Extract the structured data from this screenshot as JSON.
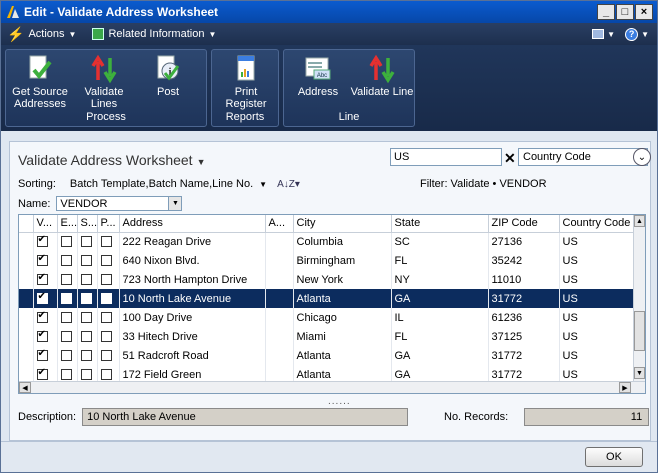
{
  "window": {
    "title": "Edit - Validate Address Worksheet"
  },
  "menu": {
    "actions": "Actions",
    "related": "Related Information"
  },
  "ribbon": {
    "groups": {
      "process": "Process",
      "reports": "Reports",
      "line": "Line"
    },
    "buttons": {
      "get_source": "Get Source Addresses",
      "validate_lines": "Validate Lines",
      "post": "Post",
      "print_register": "Print Register",
      "address": "Address",
      "validate_line": "Validate Line"
    }
  },
  "worksheet": {
    "title": "Validate Address Worksheet",
    "filter_value": "US",
    "filter_field": "Country Code",
    "sorting_label": "Sorting:",
    "sorting_value": "Batch Template,Batch Name,Line No.",
    "filter_text": "Filter: Validate • VENDOR",
    "name_label": "Name:",
    "name_value": "VENDOR"
  },
  "table": {
    "columns": [
      "V...",
      "E...",
      "S...",
      "P...",
      "Address",
      "A...",
      "City",
      "State",
      "ZIP Code",
      "Country Code"
    ],
    "rows": [
      {
        "v": true,
        "e": false,
        "s": false,
        "p": false,
        "address": "222 Reagan Drive",
        "a": "",
        "city": "Columbia",
        "state": "SC",
        "zip": "27136",
        "country": "US",
        "selected": false
      },
      {
        "v": true,
        "e": false,
        "s": false,
        "p": false,
        "address": "640 Nixon Blvd.",
        "a": "",
        "city": "Birmingham",
        "state": "FL",
        "zip": "35242",
        "country": "US",
        "selected": false
      },
      {
        "v": true,
        "e": false,
        "s": false,
        "p": false,
        "address": "723 North Hampton Drive",
        "a": "",
        "city": "New York",
        "state": "NY",
        "zip": "11010",
        "country": "US",
        "selected": false
      },
      {
        "v": true,
        "e": false,
        "s": false,
        "p": false,
        "address": "10 North Lake Avenue",
        "a": "",
        "city": "Atlanta",
        "state": "GA",
        "zip": "31772",
        "country": "US",
        "selected": true
      },
      {
        "v": true,
        "e": false,
        "s": false,
        "p": false,
        "address": "100 Day Drive",
        "a": "",
        "city": "Chicago",
        "state": "IL",
        "zip": "61236",
        "country": "US",
        "selected": false
      },
      {
        "v": true,
        "e": false,
        "s": false,
        "p": false,
        "address": "33 Hitech Drive",
        "a": "",
        "city": "Miami",
        "state": "FL",
        "zip": "37125",
        "country": "US",
        "selected": false
      },
      {
        "v": true,
        "e": false,
        "s": false,
        "p": false,
        "address": "51 Radcroft Road",
        "a": "",
        "city": "Atlanta",
        "state": "GA",
        "zip": "31772",
        "country": "US",
        "selected": false
      },
      {
        "v": true,
        "e": false,
        "s": false,
        "p": false,
        "address": "172 Field Green",
        "a": "",
        "city": "Atlanta",
        "state": "GA",
        "zip": "31772",
        "country": "US",
        "selected": false
      }
    ]
  },
  "details": {
    "description_label": "Description:",
    "description_value": "10 North Lake Avenue",
    "records_label": "No. Records:",
    "records_value": "11"
  },
  "footer": {
    "ok": "OK"
  }
}
